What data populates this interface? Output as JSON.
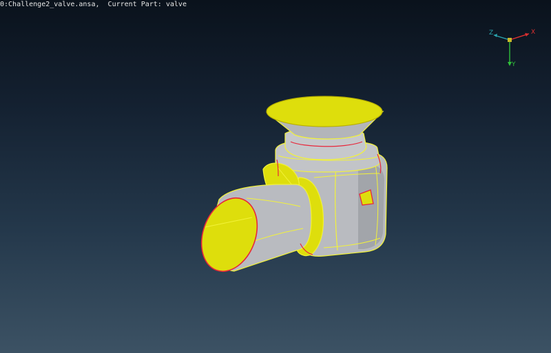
{
  "header": {
    "file_info": "0:Challenge2_valve.ansa,",
    "part_label": "Current Part:",
    "part_value": "valve"
  },
  "triad": {
    "x_label": "X",
    "y_label": "Y",
    "z_label": "Z",
    "colors": {
      "x": "#e03030",
      "y": "#2fbf3a",
      "z": "#2aa6b0",
      "origin": "#c9b92a"
    }
  },
  "model": {
    "name": "valve",
    "colors": {
      "surface_grey": "#b9bbc0",
      "surface_yellow": "#dede0c",
      "edge_yellow": "#f2f23a",
      "edge_red": "#e8263a"
    }
  }
}
